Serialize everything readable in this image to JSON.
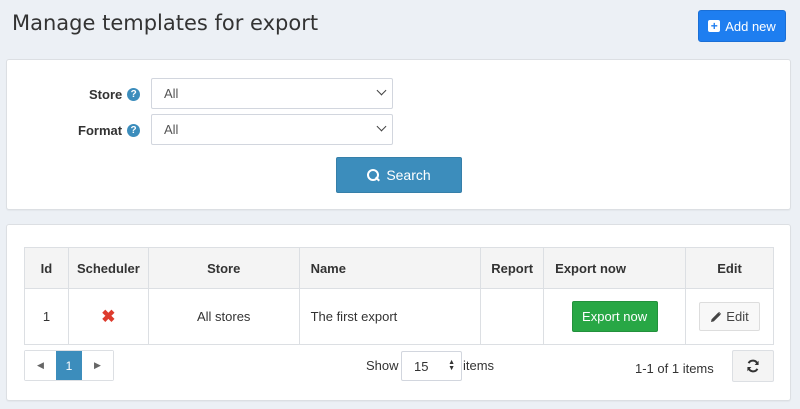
{
  "header": {
    "title": "Manage templates for export",
    "add_new_label": "Add new"
  },
  "search_panel": {
    "store_label": "Store",
    "store_value": "All",
    "format_label": "Format",
    "format_value": "All",
    "search_label": "Search"
  },
  "table": {
    "columns": [
      "Id",
      "Scheduler",
      "Store",
      "Name",
      "Report",
      "Export now",
      "Edit"
    ],
    "rows": [
      {
        "id": "1",
        "scheduler": "✖",
        "store": "All stores",
        "name": "The first export",
        "report": "",
        "export_label": "Export now",
        "edit_label": "Edit"
      }
    ]
  },
  "pagination": {
    "prev": "◀",
    "current_page": "1",
    "next": "▶",
    "show_label": "Show",
    "page_size": "15",
    "items_label": "items",
    "range_text": "1-1 of 1 items"
  },
  "colors": {
    "primary": "#1e7ef0",
    "search": "#3c8dbc",
    "export": "#28a745",
    "scheduler_off": "#dd3b2d"
  },
  "icons": {
    "add": "plus-square-icon",
    "help": "question-circle-icon",
    "search": "search-icon",
    "scheduler": "x-mark-icon",
    "edit": "pencil-icon",
    "refresh": "refresh-icon"
  }
}
